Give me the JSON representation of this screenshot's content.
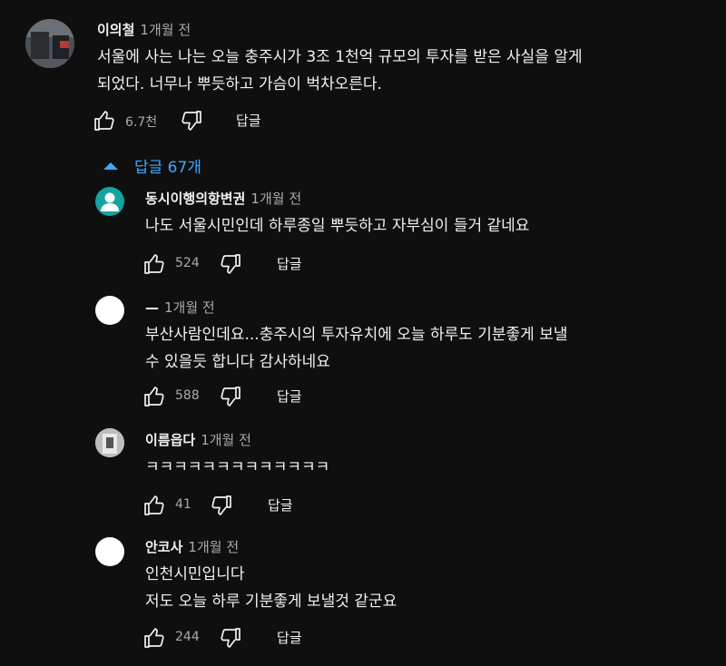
{
  "colors": {
    "background": "#0f0f0f",
    "text": "#f1f1f1",
    "muted": "#aaaaaa",
    "link": "#3ea6ff",
    "teal_avatar": "#14a3a1"
  },
  "main_comment": {
    "author": "이의철",
    "time": "1개월 전",
    "text": "서울에 사는 나는 오늘 충주시가 3조 1천억 규모의 투자를 받은 사실을 알게\n되었다. 너무나 뿌듯하고 가슴이 벅차오른다.",
    "likes": "6.7천",
    "reply_label": "답글"
  },
  "replies_toggle": {
    "label": "답글 67개",
    "icon": "caret-up-icon"
  },
  "replies": [
    {
      "author": "동시이행의항변권",
      "time": "1개월 전",
      "text": "나도 서울시민인데 하루종일 뿌듯하고 자부심이 들거 같네요",
      "likes": "524",
      "reply_label": "답글",
      "avatar": "person-icon"
    },
    {
      "author": "—",
      "time": "1개월 전",
      "text": "부산사람인데요...충주시의 투자유치에 오늘 하루도 기분좋게 보낼\n수 있을듯 합니다 감사하네요",
      "likes": "588",
      "reply_label": "답글",
      "avatar": "blank"
    },
    {
      "author": "이름읍다",
      "time": "1개월 전",
      "text": "ㅋㅋㅋㅋㅋㅋㅋㅋㅋㅋㅋㅋㅋ",
      "likes": "41",
      "reply_label": "답글",
      "avatar": "photo"
    },
    {
      "author": "안코사",
      "time": "1개월 전",
      "text": "인천시민입니다\n저도 오늘 하루 기분좋게 보낼것 같군요",
      "likes": "244",
      "reply_label": "답글",
      "avatar": "blank"
    }
  ]
}
